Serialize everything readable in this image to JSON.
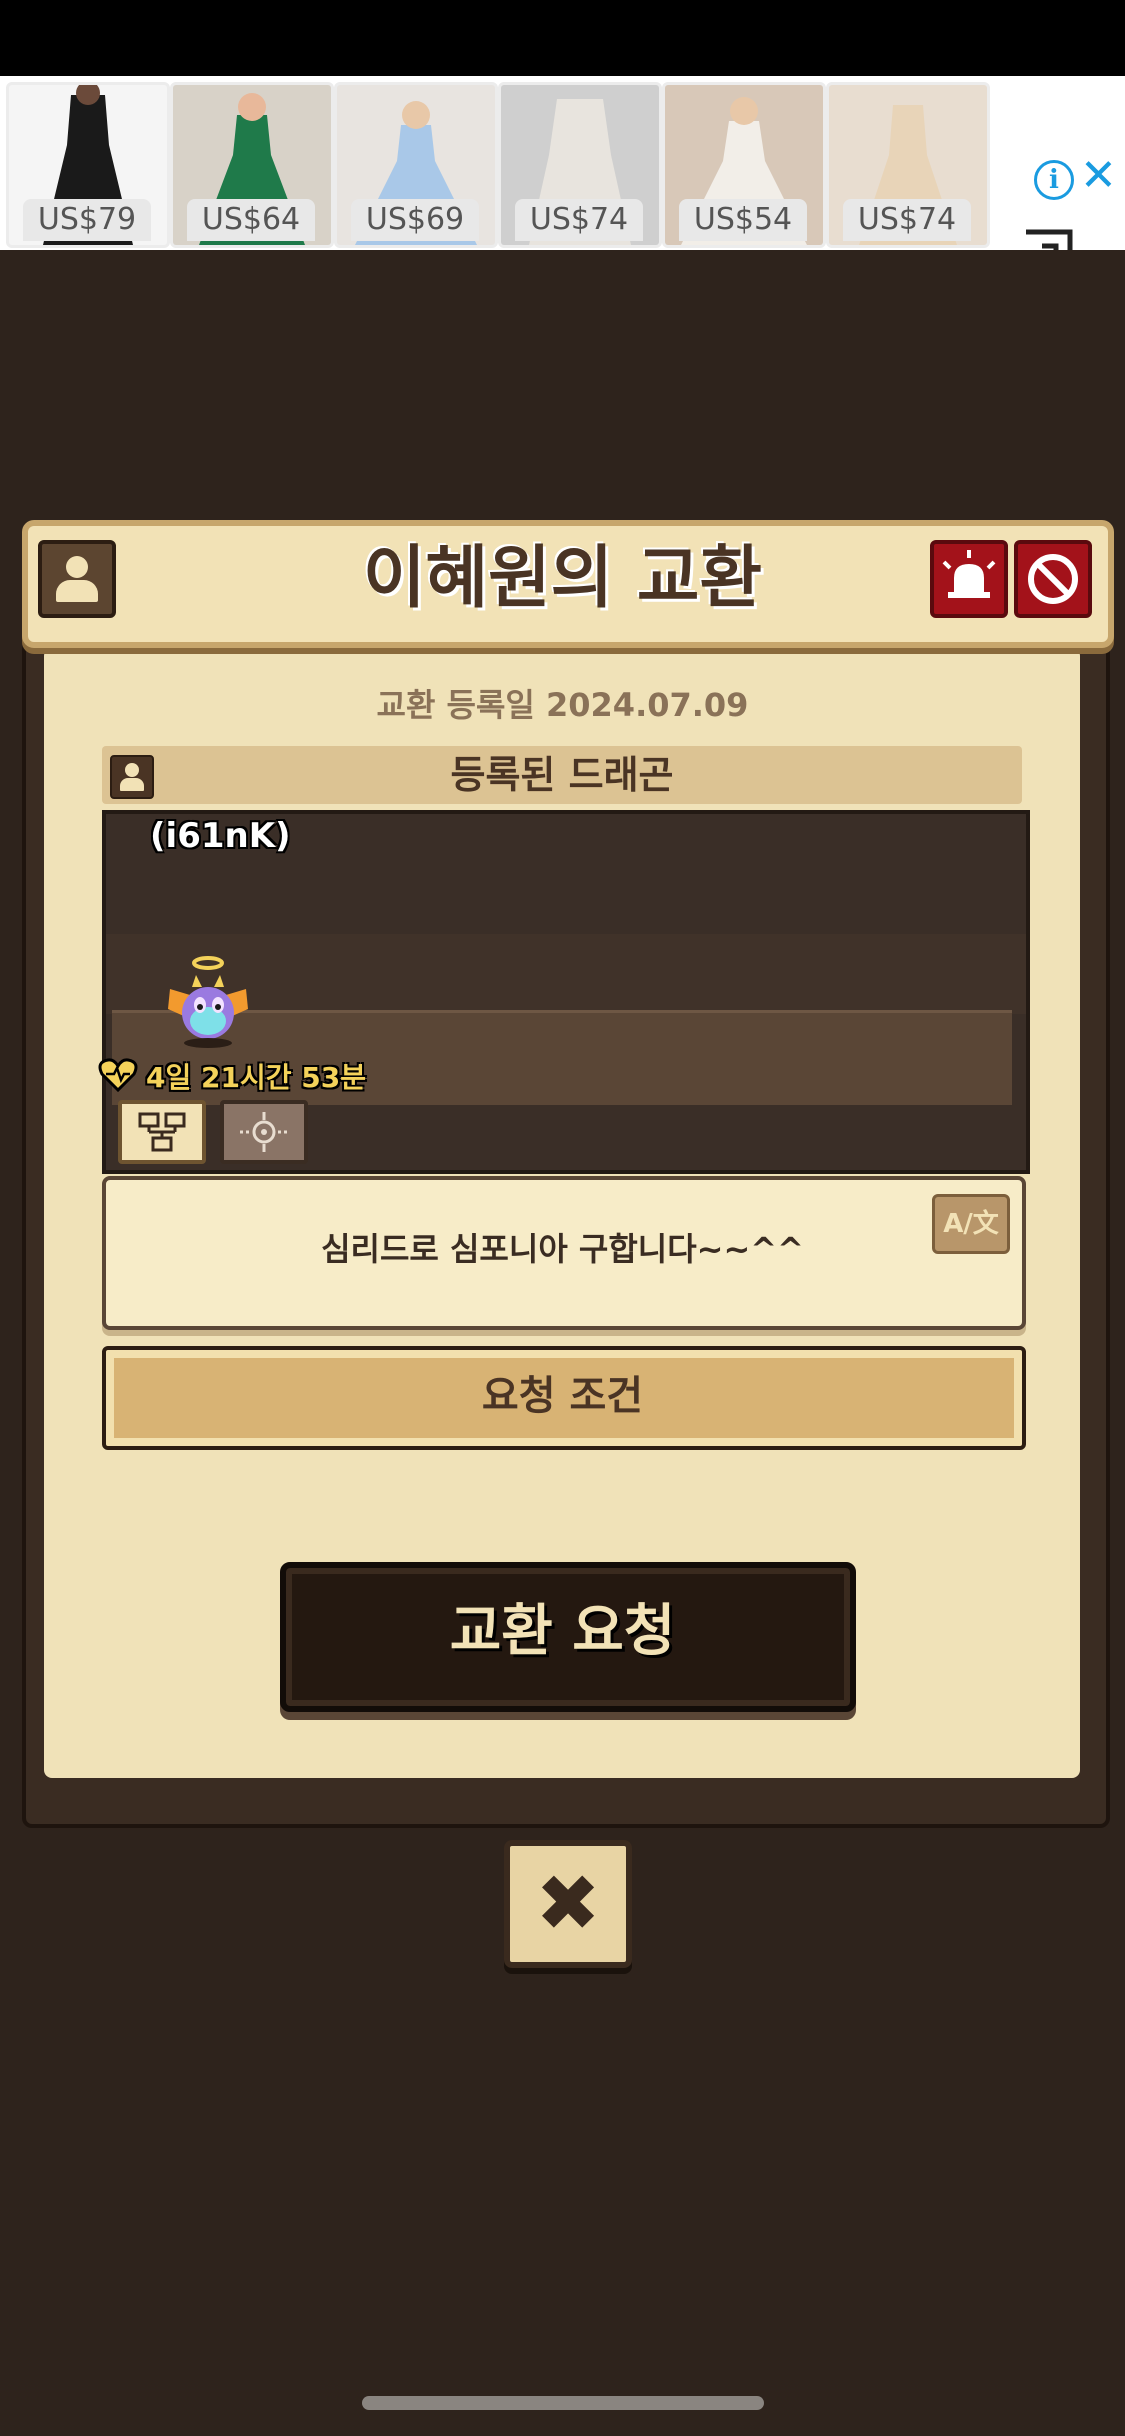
{
  "ad": {
    "items": [
      {
        "price": "US$79",
        "color": "#1a1a1a"
      },
      {
        "price": "US$64",
        "color": "#1f7a4a"
      },
      {
        "price": "US$69",
        "color": "#a9c8e8"
      },
      {
        "price": "US$74",
        "color": "#e8e4de"
      },
      {
        "price": "US$54",
        "color": "#f2eee8"
      },
      {
        "price": "US$74",
        "color": "#e8d4b8"
      }
    ],
    "info_icon": "info-icon",
    "close_icon": "close-icon"
  },
  "header": {
    "title": "이혜원의 교환"
  },
  "trade": {
    "date_label": "교환 등록일 2024.07.09",
    "section_title": "등록된 드래곤",
    "dragon_name": "(i61nK)",
    "timer": "4일 21시간 53분",
    "message": "심리드로 심포니아 구합니다~~^^",
    "translate_label": "A/文",
    "requirement_label": "요청 조건",
    "exchange_button": "교환 요청"
  },
  "close_button": "✖"
}
